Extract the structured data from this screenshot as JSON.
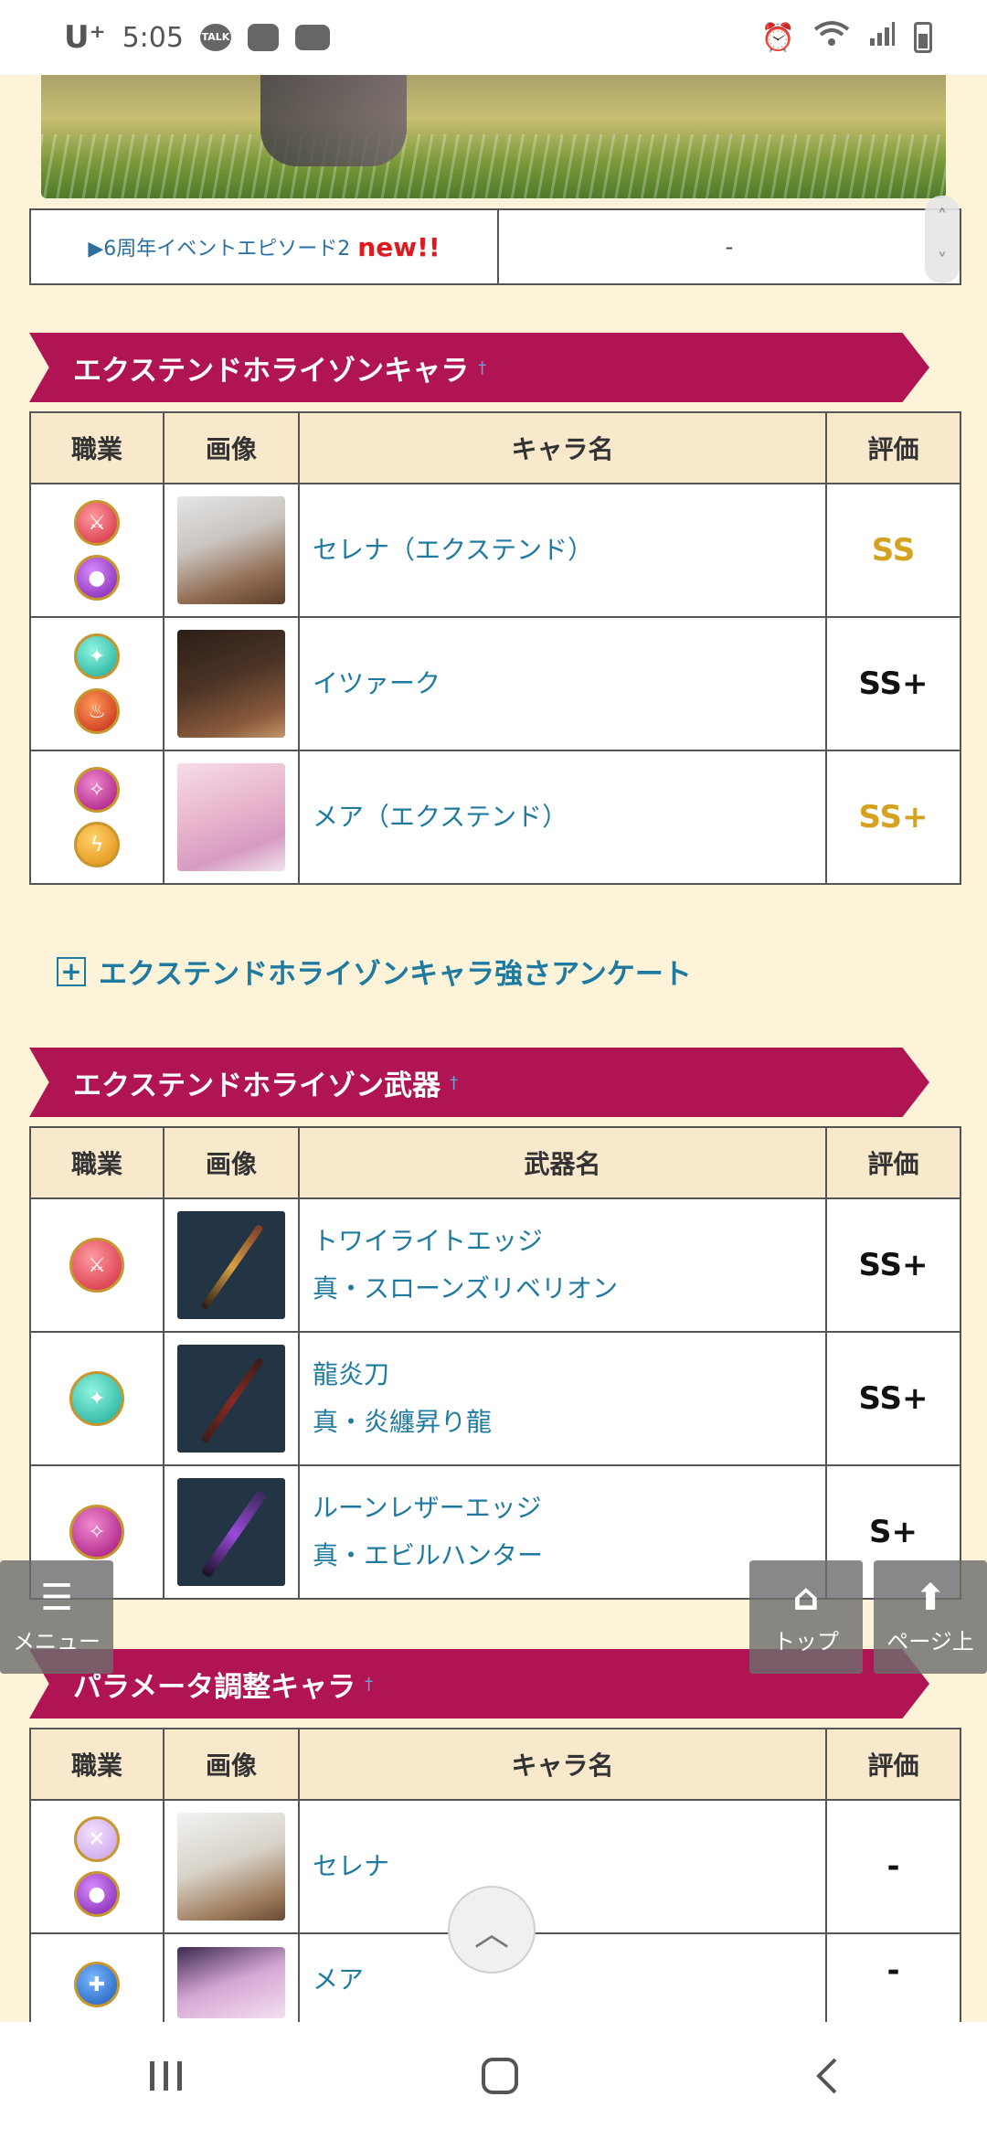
{
  "status_bar": {
    "carrier": "U⁺",
    "time": "5:05",
    "talk_badge": "TALK"
  },
  "episode_row": {
    "link_text": "▶6周年イベントエピソード2",
    "new_badge": "new!!",
    "right_value": "-"
  },
  "section_chars": {
    "title": "エクステンドホライゾンキャラ",
    "dagger": "†",
    "headers": [
      "職業",
      "画像",
      "キャラ名",
      "評価"
    ],
    "rows": [
      {
        "name": "セレナ（エクステンド）",
        "rank": "SS",
        "jobs": [
          "red",
          "purple"
        ]
      },
      {
        "name": "イツァーク",
        "rank": "SS+",
        "jobs": [
          "teal",
          "fire"
        ]
      },
      {
        "name": "メア（エクステンド）",
        "rank": "SS+",
        "jobs": [
          "magenta",
          "yellow"
        ]
      }
    ]
  },
  "survey_link": {
    "plus": "+",
    "text": "エクステンドホライゾンキャラ強さアンケート"
  },
  "section_weapons": {
    "title": "エクステンドホライゾン武器",
    "dagger": "†",
    "headers": [
      "職業",
      "画像",
      "武器名",
      "評価"
    ],
    "rows": [
      {
        "name_1": "トワイライトエッジ",
        "name_2": "真・スローンズリベリオン",
        "rank": "SS+"
      },
      {
        "name_1": "龍炎刀",
        "name_2": "真・炎纏昇り龍",
        "rank": "SS+"
      },
      {
        "name_1": "ルーンレザーエッジ",
        "name_2": "真・エビルハンター",
        "rank": "S+"
      }
    ]
  },
  "section_params": {
    "title": "パラメータ調整キャラ",
    "dagger": "†",
    "headers": [
      "職業",
      "画像",
      "キャラ名",
      "評価"
    ],
    "rows": [
      {
        "name": "セレナ",
        "rank": "-"
      },
      {
        "name": "メア",
        "rank": "-"
      }
    ]
  },
  "floating": {
    "menu_label": "メニュー",
    "top_label": "トップ",
    "pageup_label": "ページ上"
  },
  "colors": {
    "banner": "#b01452",
    "link": "#1f7aa0",
    "rank_gold": "#d4a21e",
    "page_bg": "#fdf3d8",
    "new_red": "#e0191e"
  }
}
